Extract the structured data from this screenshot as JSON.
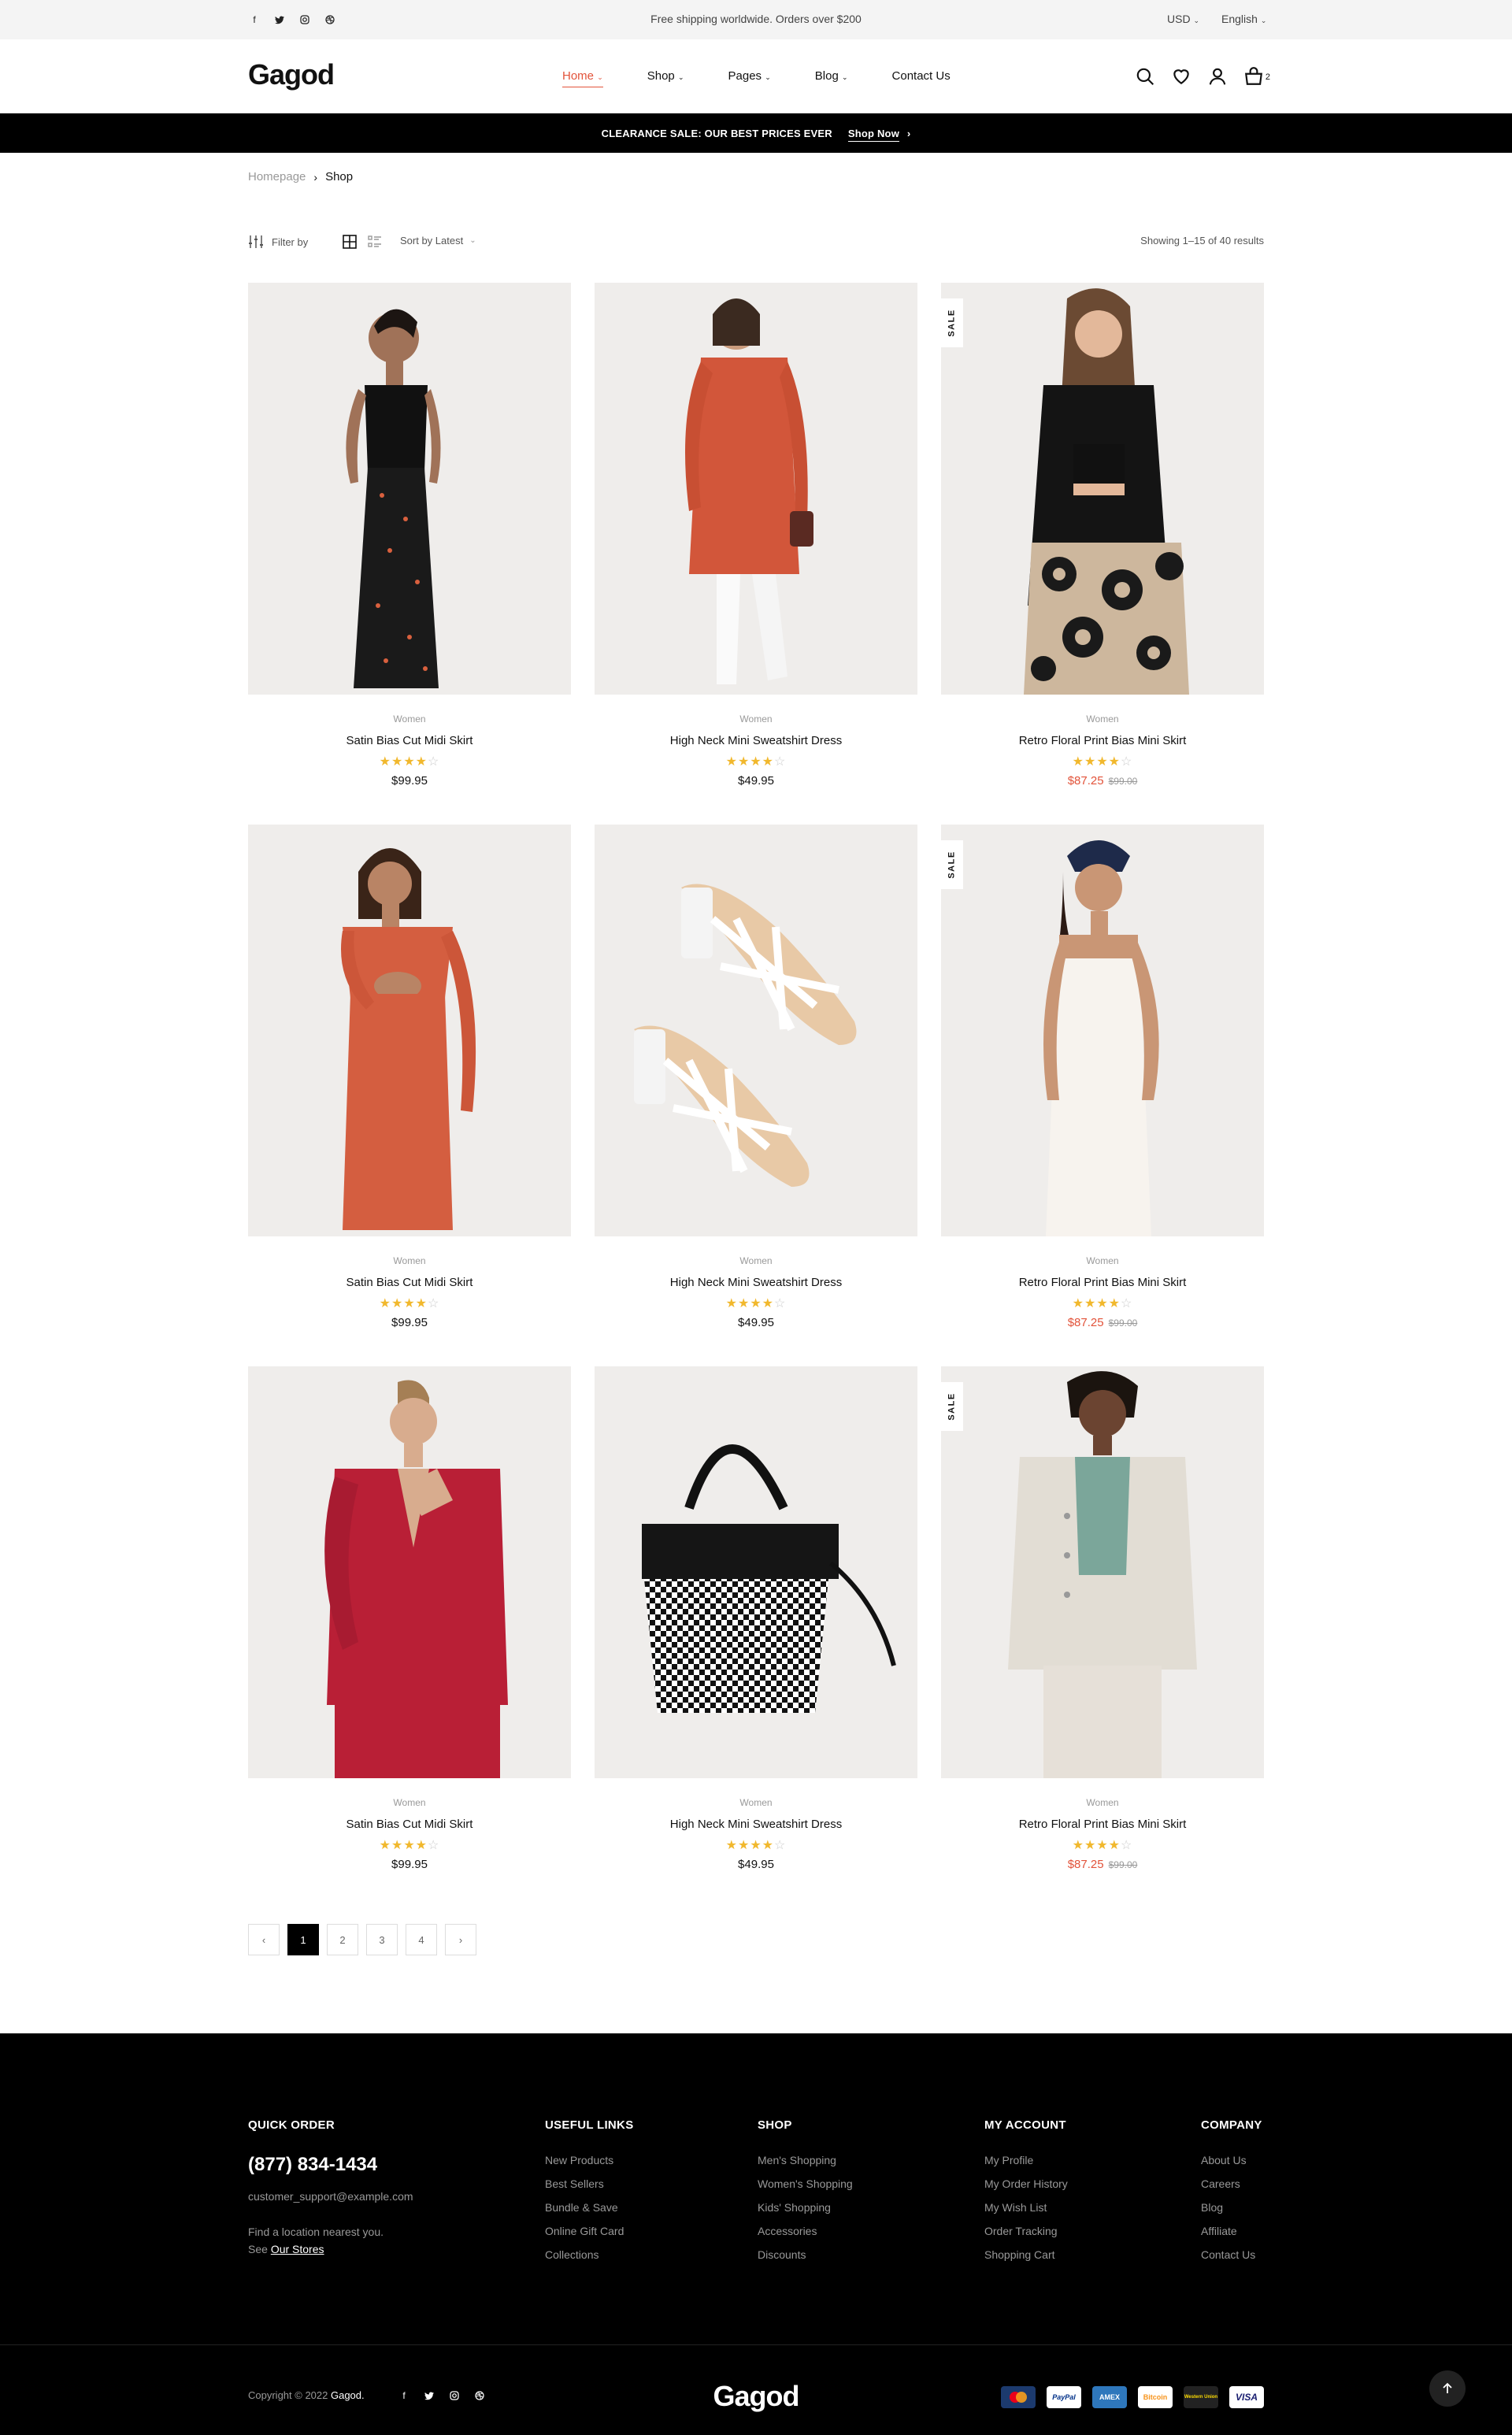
{
  "topbar": {
    "promo": "Free shipping worldwide. Orders over $200",
    "currency": "USD",
    "language": "English",
    "social": [
      "facebook-icon",
      "twitter-icon",
      "instagram-icon",
      "dribbble-icon"
    ]
  },
  "header": {
    "logo": "Gagod",
    "nav": [
      {
        "label": "Home",
        "active": true,
        "dropdown": true
      },
      {
        "label": "Shop",
        "dropdown": true
      },
      {
        "label": "Pages",
        "dropdown": true
      },
      {
        "label": "Blog",
        "dropdown": true
      },
      {
        "label": "Contact Us",
        "dropdown": false
      }
    ],
    "cart_count": "2",
    "icons": [
      "search-icon",
      "heart-icon",
      "user-icon",
      "cart-icon"
    ]
  },
  "banner": {
    "text": "CLEARANCE SALE: OUR BEST PRICES EVER",
    "cta": "Shop Now"
  },
  "breadcrumb": {
    "home": "Homepage",
    "current": "Shop"
  },
  "toolbar": {
    "filter": "Filter by",
    "sort": "Sort by Latest",
    "results": "Showing 1–15 of 40 results"
  },
  "products": [
    {
      "category": "Women",
      "name": "Satin Bias Cut Midi Skirt",
      "rating": 4,
      "price": "$99.95",
      "sale": false
    },
    {
      "category": "Women",
      "name": "High Neck Mini Sweatshirt Dress",
      "rating": 4,
      "price": "$49.95",
      "sale": false
    },
    {
      "category": "Women",
      "name": "Retro Floral Print Bias Mini Skirt",
      "rating": 4,
      "price": "$87.25",
      "old_price": "$99.00",
      "sale": true
    },
    {
      "category": "Women",
      "name": "Satin Bias Cut Midi Skirt",
      "rating": 4,
      "price": "$99.95",
      "sale": false
    },
    {
      "category": "Women",
      "name": "High Neck Mini Sweatshirt Dress",
      "rating": 4,
      "price": "$49.95",
      "sale": false
    },
    {
      "category": "Women",
      "name": "Retro Floral Print Bias Mini Skirt",
      "rating": 4,
      "price": "$87.25",
      "old_price": "$99.00",
      "sale": true
    },
    {
      "category": "Women",
      "name": "Satin Bias Cut Midi Skirt",
      "rating": 4,
      "price": "$99.95",
      "sale": false
    },
    {
      "category": "Women",
      "name": "High Neck Mini Sweatshirt Dress",
      "rating": 4,
      "price": "$49.95",
      "sale": false
    },
    {
      "category": "Women",
      "name": "Retro Floral Print Bias Mini Skirt",
      "rating": 4,
      "price": "$87.25",
      "old_price": "$99.00",
      "sale": true
    }
  ],
  "sale_label": "SALE",
  "pagination": {
    "prev": "‹",
    "pages": [
      "1",
      "2",
      "3",
      "4"
    ],
    "active": "1",
    "next": "›"
  },
  "footer": {
    "quick_order": {
      "title": "QUICK ORDER",
      "phone": "(877) 834-1434",
      "email": "customer_support@example.com",
      "find1": "Find a location nearest you.",
      "find2": "See",
      "stores": "Our Stores"
    },
    "columns": [
      {
        "title": "USEFUL LINKS",
        "links": [
          "New Products",
          "Best Sellers",
          "Bundle & Save",
          "Online Gift Card",
          "Collections"
        ]
      },
      {
        "title": "SHOP",
        "links": [
          "Men's Shopping",
          "Women's Shopping",
          "Kids' Shopping",
          "Accessories",
          "Discounts"
        ]
      },
      {
        "title": "MY ACCOUNT",
        "links": [
          "My Profile",
          "My Order History",
          "My Wish List",
          "Order Tracking",
          "Shopping Cart"
        ]
      },
      {
        "title": "COMPANY",
        "links": [
          "About Us",
          "Careers",
          "Blog",
          "Affiliate",
          "Contact Us"
        ]
      }
    ],
    "copyright": "Copyright © 2022",
    "brand": "Gagod.",
    "logo": "Gagod",
    "payments": [
      "MasterCard",
      "PayPal",
      "AMEX",
      "Bitcoin",
      "Western Union",
      "VISA"
    ]
  },
  "colors": {
    "accent": "#e2533a",
    "star": "#f1b82d",
    "dark": "#000000",
    "image_bg": "#efedeb"
  }
}
